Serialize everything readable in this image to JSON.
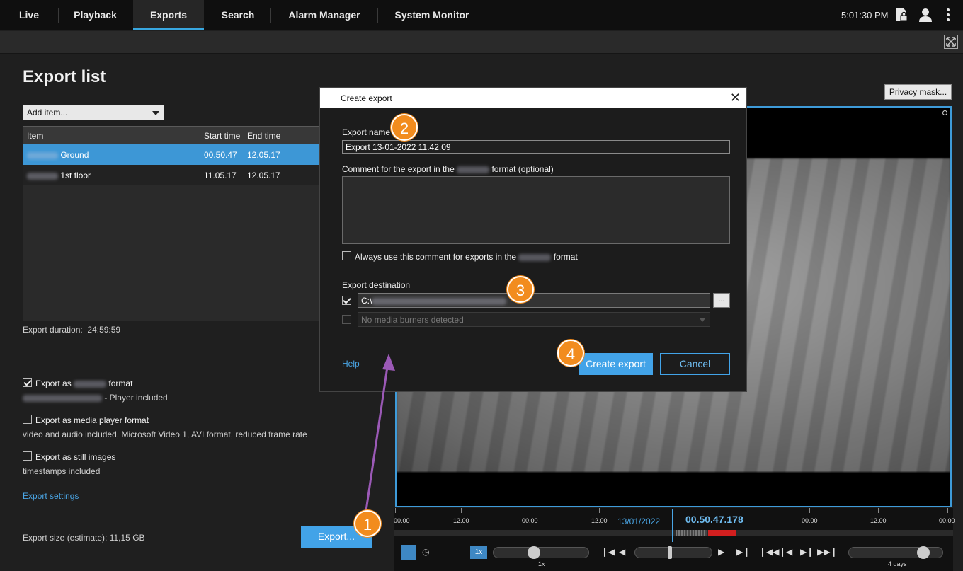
{
  "nav": {
    "tabs": [
      "Live",
      "Playback",
      "Exports",
      "Search",
      "Alarm Manager",
      "System Monitor"
    ],
    "active": "Exports",
    "clock": "5:01:30 PM"
  },
  "export_list": {
    "title": "Export list",
    "add_item": "Add item...",
    "columns": {
      "item": "Item",
      "start": "Start time",
      "end": "End time"
    },
    "rows": [
      {
        "name": "Ground",
        "start": "00.50.47",
        "end": "12.05.17"
      },
      {
        "name": "1st floor",
        "start": "11.05.17",
        "end": "12.05.17"
      }
    ],
    "duration_label": "Export duration:",
    "duration_value": "24:59:59"
  },
  "options": {
    "native_prefix": "Export as",
    "native_suffix": "format",
    "native_sub": "- Player included",
    "native_checked": true,
    "media_label": "Export as media player format",
    "media_sub": "video and audio included, Microsoft Video 1, AVI format, reduced frame rate",
    "media_checked": false,
    "still_label": "Export as still images",
    "still_sub": "timestamps included",
    "still_checked": false,
    "settings_link": "Export settings",
    "size_label": "Export size (estimate):",
    "size_value": "11,15 GB",
    "export_button": "Export..."
  },
  "video": {
    "privacy_button": "Privacy mask..."
  },
  "timeline": {
    "labels": [
      "00.00",
      "12.00",
      "00.00",
      "12.00",
      "00.00",
      "12.00",
      "00.00",
      "12.00"
    ],
    "date": "13/01/2022",
    "time": "00.50.47.178",
    "speed": "1x",
    "speed_sub": "1x",
    "range_sub": "4 days"
  },
  "dialog": {
    "title": "Create export",
    "name_label": "Export name",
    "name_value": "Export 13-01-2022 11.42.09",
    "comment_prefix": "Comment for the export in the",
    "comment_suffix": "format (optional)",
    "always_prefix": "Always use this comment for exports in the",
    "always_suffix": "format",
    "destination_label": "Export destination",
    "path_prefix": "C:\\",
    "no_burners": "No media burners detected",
    "browse": "...",
    "help": "Help",
    "create": "Create export",
    "cancel": "Cancel"
  },
  "callouts": [
    "1",
    "2",
    "3",
    "4"
  ],
  "colors": {
    "accent": "#42a3e8",
    "callout": "#f28c1e",
    "arrow": "#9b59b6",
    "marker": "#d21f1f"
  }
}
